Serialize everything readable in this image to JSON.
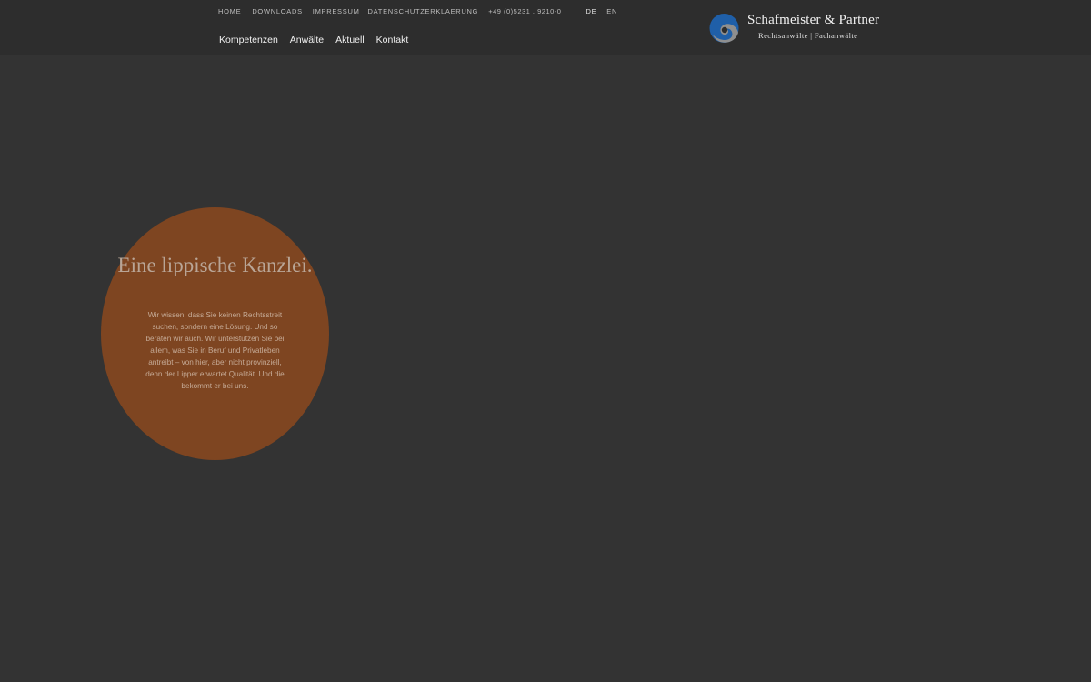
{
  "topnav": {
    "home": "HOME",
    "downloads": "DOWNLOADS",
    "impressum": "IMPRESSUM",
    "datenschutz": "DATENSCHUTZERKLAERUNG",
    "phone": "+49 (0)5231 . 9210-0",
    "lang_de": "DE",
    "lang_en": "EN"
  },
  "mainnav": {
    "items": [
      "Kompetenzen",
      "Anwälte",
      "Aktuell",
      "Kontakt"
    ]
  },
  "logo": {
    "name": "Schafmeister & Partner",
    "subtitle": "Rechtsanwälte | Fachanwälte",
    "icon": "swirl-logo-icon",
    "colors": {
      "blue": "#1f5fa8",
      "grey": "#8f8f8f"
    }
  },
  "hero": {
    "headline": "Eine lippische Kanzlei.",
    "body": "Wir wissen, dass Sie keinen Rechtsstreit suchen, sondern eine Lösung. Und so beraten wir auch. Wir unterstützen Sie bei allem, was Sie in Beruf und Privatleben antreibt – von hier, aber nicht provinziell, denn der Lipper erwartet Qualität. Und die bekommt er bei uns.",
    "circle_color": "#7e4521"
  },
  "colors": {
    "background": "#333333",
    "header": "#2d2d2d"
  }
}
